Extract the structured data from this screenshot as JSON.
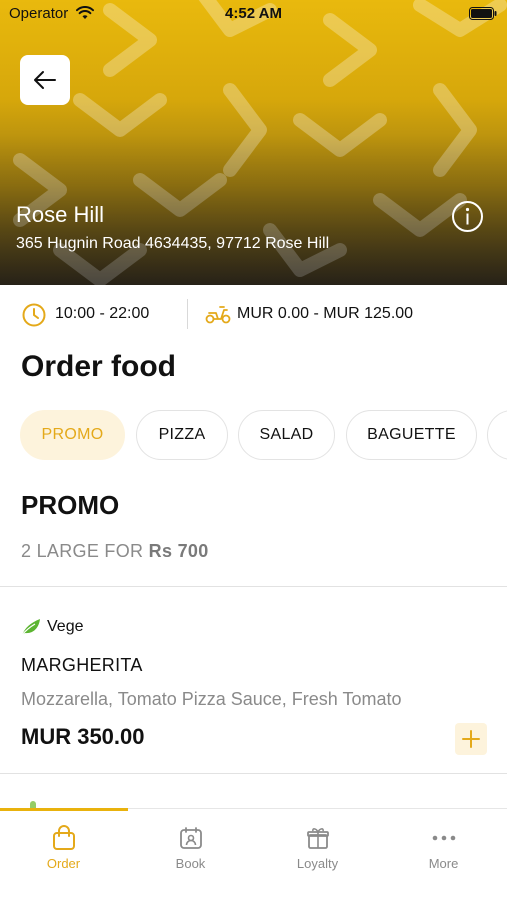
{
  "status_bar": {
    "carrier": "Operator",
    "time": "4:52 AM"
  },
  "store": {
    "name": "Rose Hill",
    "address": "365 Hugnin Road 4634435, 97712 Rose Hill"
  },
  "meta": {
    "hours": "10:00 - 22:00",
    "delivery_fee": "MUR 0.00 - MUR 125.00"
  },
  "section_title": "Order food",
  "categories": [
    {
      "label": "PROMO",
      "active": true
    },
    {
      "label": "PIZZA",
      "active": false
    },
    {
      "label": "SALAD",
      "active": false
    },
    {
      "label": "BAGUETTE",
      "active": false
    }
  ],
  "promo": {
    "title": "PROMO",
    "subtitle_prefix": "2 LARGE FOR",
    "subtitle_price": "Rs 700"
  },
  "product": {
    "tag": "Vege",
    "name": "MARGHERITA",
    "description": "Mozzarella, Tomato Pizza Sauce, Fresh Tomato",
    "price": "MUR 350.00"
  },
  "tabs": [
    {
      "label": "Order",
      "icon": "bag-icon",
      "active": true
    },
    {
      "label": "Book",
      "icon": "calendar-user-icon",
      "active": false
    },
    {
      "label": "Loyalty",
      "icon": "gift-icon",
      "active": false
    },
    {
      "label": "More",
      "icon": "more-dots-icon",
      "active": false
    }
  ],
  "colors": {
    "accent": "#e9b20d",
    "accent_text": "#e4a91a",
    "chip_active_bg": "#fdf3dc",
    "vege_green": "#5cb531",
    "muted_text": "#8a8a8a"
  }
}
